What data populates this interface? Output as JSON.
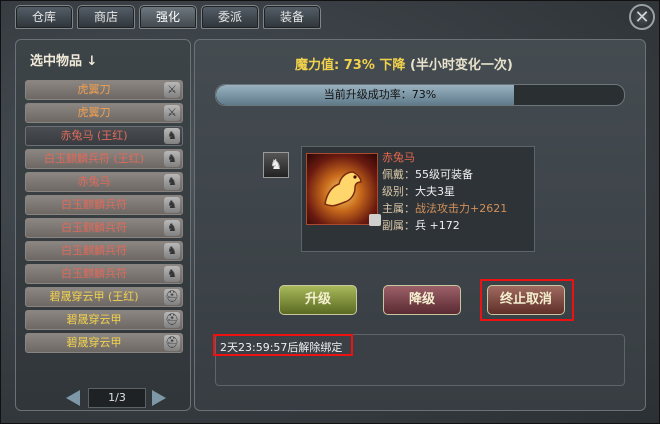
{
  "tabs": [
    {
      "label": "仓库",
      "active": false
    },
    {
      "label": "商店",
      "active": false
    },
    {
      "label": "强化",
      "active": true
    },
    {
      "label": "委派",
      "active": false
    },
    {
      "label": "装备",
      "active": false
    }
  ],
  "close_icon": "close-x-icon",
  "left_panel": {
    "title": "选中物品 ↓",
    "items": [
      {
        "label": "虎翼刀",
        "color": "orange",
        "icon": "sword-icon",
        "selected": false
      },
      {
        "label": "虎翼刀",
        "color": "orange",
        "icon": "sword-icon",
        "selected": false
      },
      {
        "label": "赤兔马 (王红)",
        "color": "red",
        "icon": "horse-icon",
        "selected": true
      },
      {
        "label": "白玉麒麟兵符 (王红)",
        "color": "red",
        "icon": "horse-icon",
        "selected": false
      },
      {
        "label": "赤兔马",
        "color": "red",
        "icon": "horse-icon",
        "selected": false
      },
      {
        "label": "白玉麒麟兵符",
        "color": "red",
        "icon": "horse-icon",
        "selected": false
      },
      {
        "label": "白玉麒麟兵符",
        "color": "red",
        "icon": "horse-icon",
        "selected": false
      },
      {
        "label": "白玉麒麟兵符",
        "color": "red",
        "icon": "horse-icon",
        "selected": false
      },
      {
        "label": "白玉麒麟兵符",
        "color": "red",
        "icon": "horse-icon",
        "selected": false
      },
      {
        "label": "碧晟穿云甲 (王红)",
        "color": "gold",
        "icon": "helmet-icon",
        "selected": false
      },
      {
        "label": "碧晟穿云甲",
        "color": "gold",
        "icon": "helmet-icon",
        "selected": false
      },
      {
        "label": "碧晟穿云甲",
        "color": "gold",
        "icon": "helmet-icon",
        "selected": false
      }
    ],
    "pager": {
      "text": "1/3"
    }
  },
  "right_panel": {
    "magic_label": "魔力值:",
    "magic_value": "73%",
    "magic_trend": "下降",
    "magic_note": "(半小时变化一次)",
    "progress": {
      "text": "当前升级成功率：73%",
      "value": 0.73
    },
    "item": {
      "name": "赤兔马",
      "line1_label": "佩戴：",
      "line1_value": "55级可装备",
      "line2_label": "级别：",
      "line2_value": "大夫3星",
      "line3_label": "主属：",
      "line3_value": "战法攻击力+2621",
      "line4_label": "副属：",
      "line4_value": "兵 +172"
    },
    "buttons": {
      "upgrade": "升级",
      "downgrade": "降级",
      "stop": "终止取消"
    },
    "message": "2天23:59:57后解除绑定"
  }
}
